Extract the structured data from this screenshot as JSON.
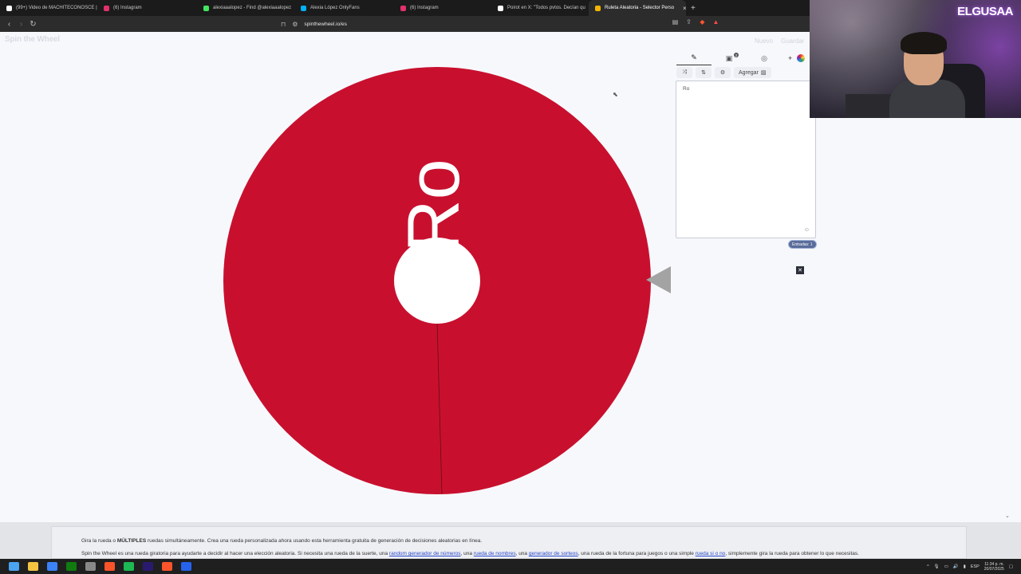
{
  "browser": {
    "tabs": [
      {
        "label": "(99+) Video de MACHITECONOSCE |",
        "icon": "tiktok-icon",
        "color": "#ffffff",
        "active": false
      },
      {
        "label": "(6) Instagram",
        "icon": "instagram-icon",
        "color": "#e1306c",
        "active": false
      },
      {
        "label": "alexiaaalopez - Find @alexiaaalopez",
        "icon": "linktree-icon",
        "color": "#43e660",
        "active": false
      },
      {
        "label": "Alexia López OnlyFans",
        "icon": "onlyfans-icon",
        "color": "#00aff0",
        "active": false
      },
      {
        "label": "(6) Instagram",
        "icon": "instagram-icon",
        "color": "#e1306c",
        "active": false
      },
      {
        "label": "Poirot en X: \"Todos pvtos. Decían qu",
        "icon": "x-icon",
        "color": "#ffffff",
        "active": false
      },
      {
        "label": "Ruleta Aleatoria - Selector Perso",
        "icon": "spinwheel-icon",
        "color": "#f4b400",
        "active": true
      }
    ],
    "new_tab": "+",
    "url": "spinthewheel.io/es"
  },
  "page": {
    "logo": "Spin the Wheel",
    "nav": [
      "Nuevo",
      "Guardar"
    ],
    "wheel": {
      "segments": [
        {
          "label": "Ro",
          "color": "#c8102e"
        }
      ]
    },
    "editor": {
      "add_label": "Agregar",
      "entries_text": "Ro",
      "entries_count": "Entradas: 1",
      "tab_badge": "2"
    },
    "footer": {
      "line1_a": "Gira la rueda o ",
      "line1_bold": "MÚLTIPLES",
      "line1_b": " ruedas simultáneamente. Crea una rueda personalizada ahora usando esta herramienta gratuita de generación de decisiones aleatorias en línea.",
      "line2_a": "Spin the Wheel es una rueda giratoria para ayudarte a decidir al hacer una elección aleatoria. Si necesita una rueda de la suerte, una ",
      "link1": "random generador de números",
      "line2_b": ", una ",
      "link2": "rueda de nombres",
      "line2_c": ", una ",
      "link3": "generador de sorteos",
      "line2_d": ", una rueda de la fortuna para juegos o una simple ",
      "link4": "rueda si o no",
      "line2_e": ", simplemente gira la rueda para obtener lo que necesitas."
    }
  },
  "webcam": {
    "brand": "ELGUSAA"
  },
  "taskbar": {
    "icons": [
      {
        "name": "windows-start-icon",
        "color": "#4aa3f0"
      },
      {
        "name": "file-explorer-icon",
        "color": "#f5c542"
      },
      {
        "name": "calendar-icon",
        "color": "#3b82f6"
      },
      {
        "name": "xbox-icon",
        "color": "#107c10"
      },
      {
        "name": "terminal-icon",
        "color": "#888888"
      },
      {
        "name": "brave-browser-icon",
        "color": "#fb542b"
      },
      {
        "name": "spotify-icon",
        "color": "#1db954"
      },
      {
        "name": "premiere-icon",
        "color": "#2a1a6e"
      },
      {
        "name": "brave-browser-icon",
        "color": "#fb542b"
      },
      {
        "name": "generic-app-icon",
        "color": "#2563eb"
      }
    ],
    "lang": "ESP",
    "time": "11:34 p. m.",
    "date": "20/07/2025"
  }
}
